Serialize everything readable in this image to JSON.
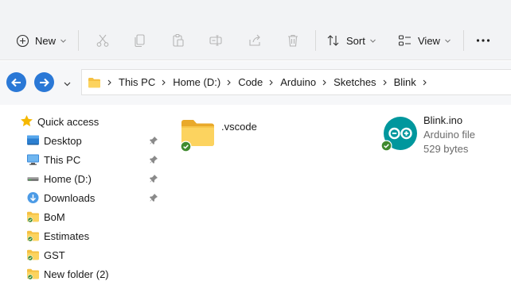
{
  "toolbar": {
    "new_label": "New",
    "sort_label": "Sort",
    "view_label": "View",
    "more_label": "..."
  },
  "address": {
    "crumbs": [
      "This PC",
      "Home (D:)",
      "Code",
      "Arduino",
      "Sketches",
      "Blink"
    ]
  },
  "sidebar": {
    "quick_access_label": "Quick access",
    "items": [
      {
        "label": "Desktop",
        "icon": "desktop-icon",
        "pinned": true
      },
      {
        "label": "This PC",
        "icon": "computer-icon",
        "pinned": true
      },
      {
        "label": "Home (D:)",
        "icon": "drive-icon",
        "pinned": true
      },
      {
        "label": "Downloads",
        "icon": "download-icon",
        "pinned": true
      },
      {
        "label": "BoM",
        "icon": "folder-icon",
        "pinned": false
      },
      {
        "label": "Estimates",
        "icon": "folder-icon",
        "pinned": false
      },
      {
        "label": "GST",
        "icon": "folder-icon",
        "pinned": false
      },
      {
        "label": "New folder (2)",
        "icon": "folder-icon",
        "pinned": false
      }
    ]
  },
  "files": [
    {
      "name": ".vscode",
      "icon": "folder-icon",
      "synced": true
    },
    {
      "name": "Blink.ino",
      "type": "Arduino file",
      "size": "529 bytes",
      "icon": "arduino-icon",
      "synced": true
    }
  ],
  "colors": {
    "accent": "#2a78d6",
    "folder": "#f5c042",
    "sync_ok": "#3f8a2e",
    "arduino": "#00979d"
  }
}
